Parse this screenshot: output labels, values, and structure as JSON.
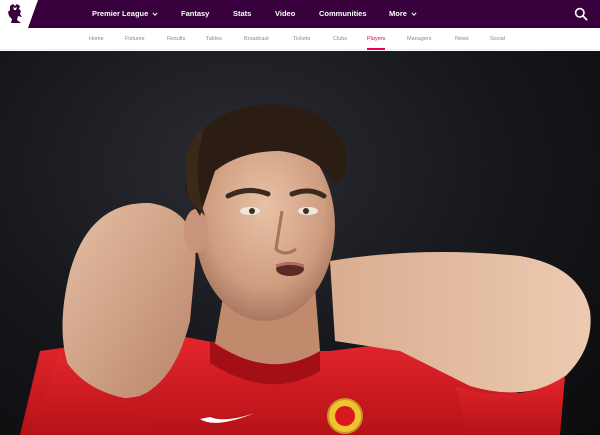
{
  "header": {
    "main_nav": [
      {
        "label": "Premier League",
        "has_dropdown": true
      },
      {
        "label": "Fantasy",
        "has_dropdown": false
      },
      {
        "label": "Stats",
        "has_dropdown": false
      },
      {
        "label": "Video",
        "has_dropdown": false
      },
      {
        "label": "Communities",
        "has_dropdown": false
      },
      {
        "label": "More",
        "has_dropdown": true
      }
    ],
    "search_icon": "search-icon",
    "logo_icon": "premier-league-lion-logo"
  },
  "subnav": {
    "items": [
      {
        "label": "Home"
      },
      {
        "label": "Fixtures"
      },
      {
        "label": "Results"
      },
      {
        "label": "Tables"
      },
      {
        "label": "Broadcast"
      },
      {
        "label": "Tickets"
      },
      {
        "label": "Clubs"
      },
      {
        "label": "Players"
      },
      {
        "label": "Managers"
      },
      {
        "label": "News"
      },
      {
        "label": "Social"
      }
    ],
    "active_label": "Players"
  },
  "colors": {
    "brand_purple": "#38003c",
    "accent_pink": "#e90052",
    "subnav_text": "#8a8a8a",
    "kit_red": "#d81920"
  }
}
